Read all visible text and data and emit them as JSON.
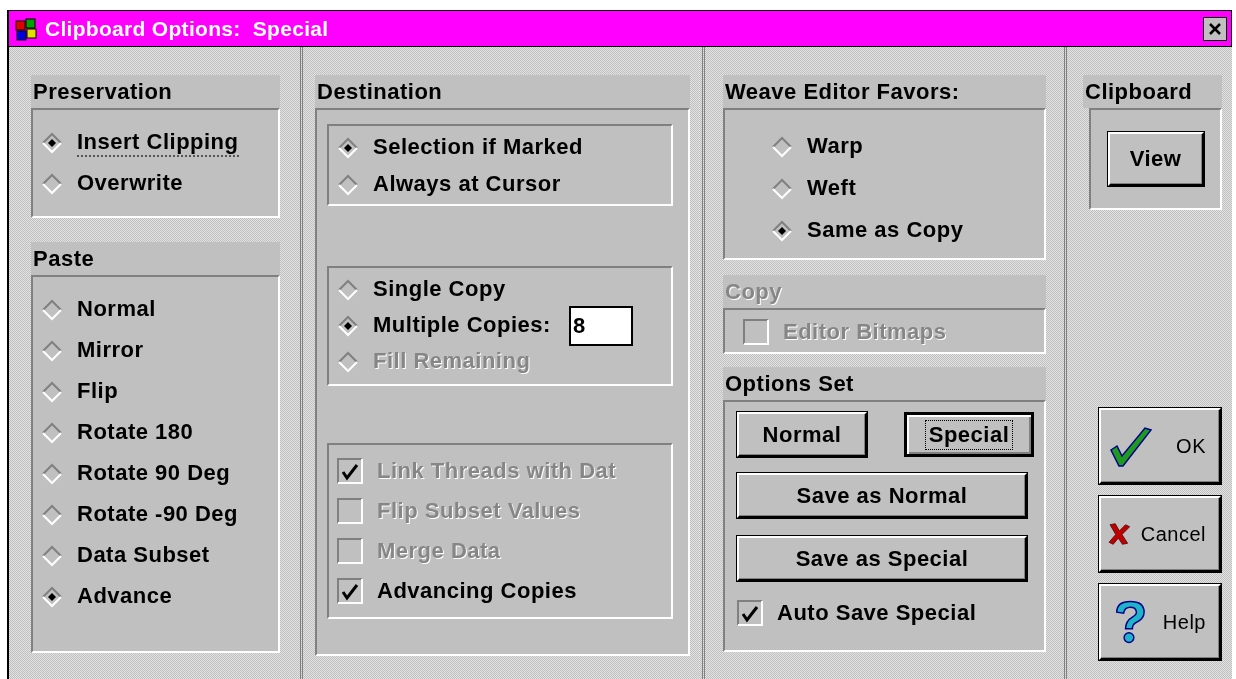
{
  "window": {
    "title": "Clipboard Options:  Special"
  },
  "preservation": {
    "title": "Preservation",
    "options": [
      {
        "label": "Insert Clipping",
        "selected": true,
        "focused": true
      },
      {
        "label": "Overwrite",
        "selected": false,
        "focused": false
      }
    ]
  },
  "paste": {
    "title": "Paste",
    "options": [
      {
        "label": "Normal",
        "selected": false
      },
      {
        "label": "Mirror",
        "selected": false
      },
      {
        "label": "Flip",
        "selected": false
      },
      {
        "label": "Rotate 180",
        "selected": false
      },
      {
        "label": "Rotate 90 Deg",
        "selected": false
      },
      {
        "label": "Rotate -90 Deg",
        "selected": false
      },
      {
        "label": "Data Subset",
        "selected": false
      },
      {
        "label": "Advance",
        "selected": true
      }
    ]
  },
  "destination": {
    "title": "Destination",
    "target": [
      {
        "label": "Selection if Marked",
        "selected": true
      },
      {
        "label": "Always at Cursor",
        "selected": false
      }
    ],
    "copies": [
      {
        "label": "Single Copy",
        "selected": false,
        "disabled": false
      },
      {
        "label": "Multiple Copies:",
        "selected": true,
        "disabled": false,
        "value": "8"
      },
      {
        "label": "Fill Remaining",
        "selected": false,
        "disabled": true
      }
    ],
    "flags": [
      {
        "label": "Link Threads with Dat",
        "checked": true,
        "disabled": true
      },
      {
        "label": "Flip Subset Values",
        "checked": false,
        "disabled": true
      },
      {
        "label": "Merge Data",
        "checked": false,
        "disabled": true
      },
      {
        "label": "Advancing Copies",
        "checked": true,
        "disabled": false
      }
    ]
  },
  "weave_editor_favors": {
    "title": "Weave Editor Favors:",
    "options": [
      {
        "label": "Warp",
        "selected": false
      },
      {
        "label": "Weft",
        "selected": false
      },
      {
        "label": "Same as Copy",
        "selected": true
      }
    ]
  },
  "copy": {
    "title": "Copy",
    "disabled": true,
    "options": [
      {
        "label": "Editor Bitmaps",
        "checked": false,
        "disabled": true
      }
    ]
  },
  "options_set": {
    "title": "Options Set",
    "modes": [
      {
        "label": "Normal",
        "selected": false
      },
      {
        "label": "Special",
        "selected": true
      }
    ],
    "actions": [
      "Save as Normal",
      "Save as Special"
    ],
    "auto_save": {
      "label": "Auto Save Special",
      "checked": true
    }
  },
  "clipboard": {
    "title": "Clipboard",
    "button": "View"
  },
  "dialog_buttons": [
    {
      "label": "OK",
      "kind": "ok"
    },
    {
      "label": "Cancel",
      "kind": "cancel"
    },
    {
      "label": "Help",
      "kind": "help"
    }
  ]
}
